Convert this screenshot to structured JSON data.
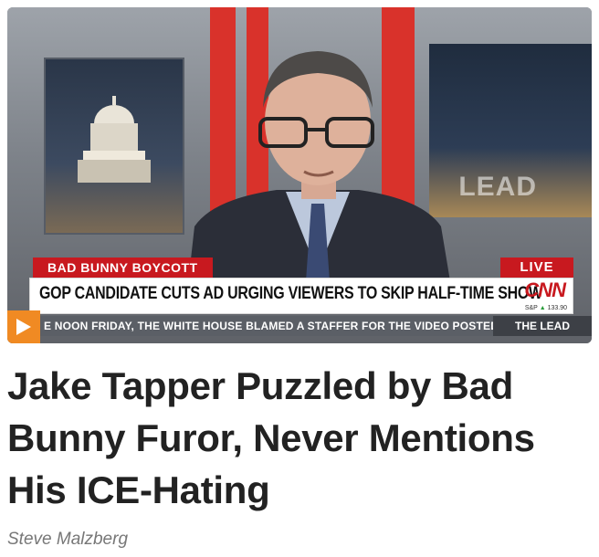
{
  "video": {
    "kicker": "BAD BUNNY BOYCOTT",
    "live_label": "LIVE",
    "headline": "GOP CANDIDATE CUTS AD URGING VIEWERS TO SKIP HALF-TIME SHOW",
    "network_logo": "CNN",
    "stock_label": "S&P",
    "stock_value": "133.90",
    "ticker_text": "E NOON FRIDAY, THE WHITE HOUSE BLAMED A STAFFER FOR THE VIDEO POSTED T",
    "show_name": "THE LEAD",
    "background_wall_text": "LEAD",
    "play_icon": "play-icon",
    "accent_color": "#f08a23",
    "brand_red": "#c8191f"
  },
  "article": {
    "title": "Jake Tapper Puzzled by Bad Bunny Furor, Never Mentions His ICE-Hating",
    "author": "Steve Malzberg"
  }
}
